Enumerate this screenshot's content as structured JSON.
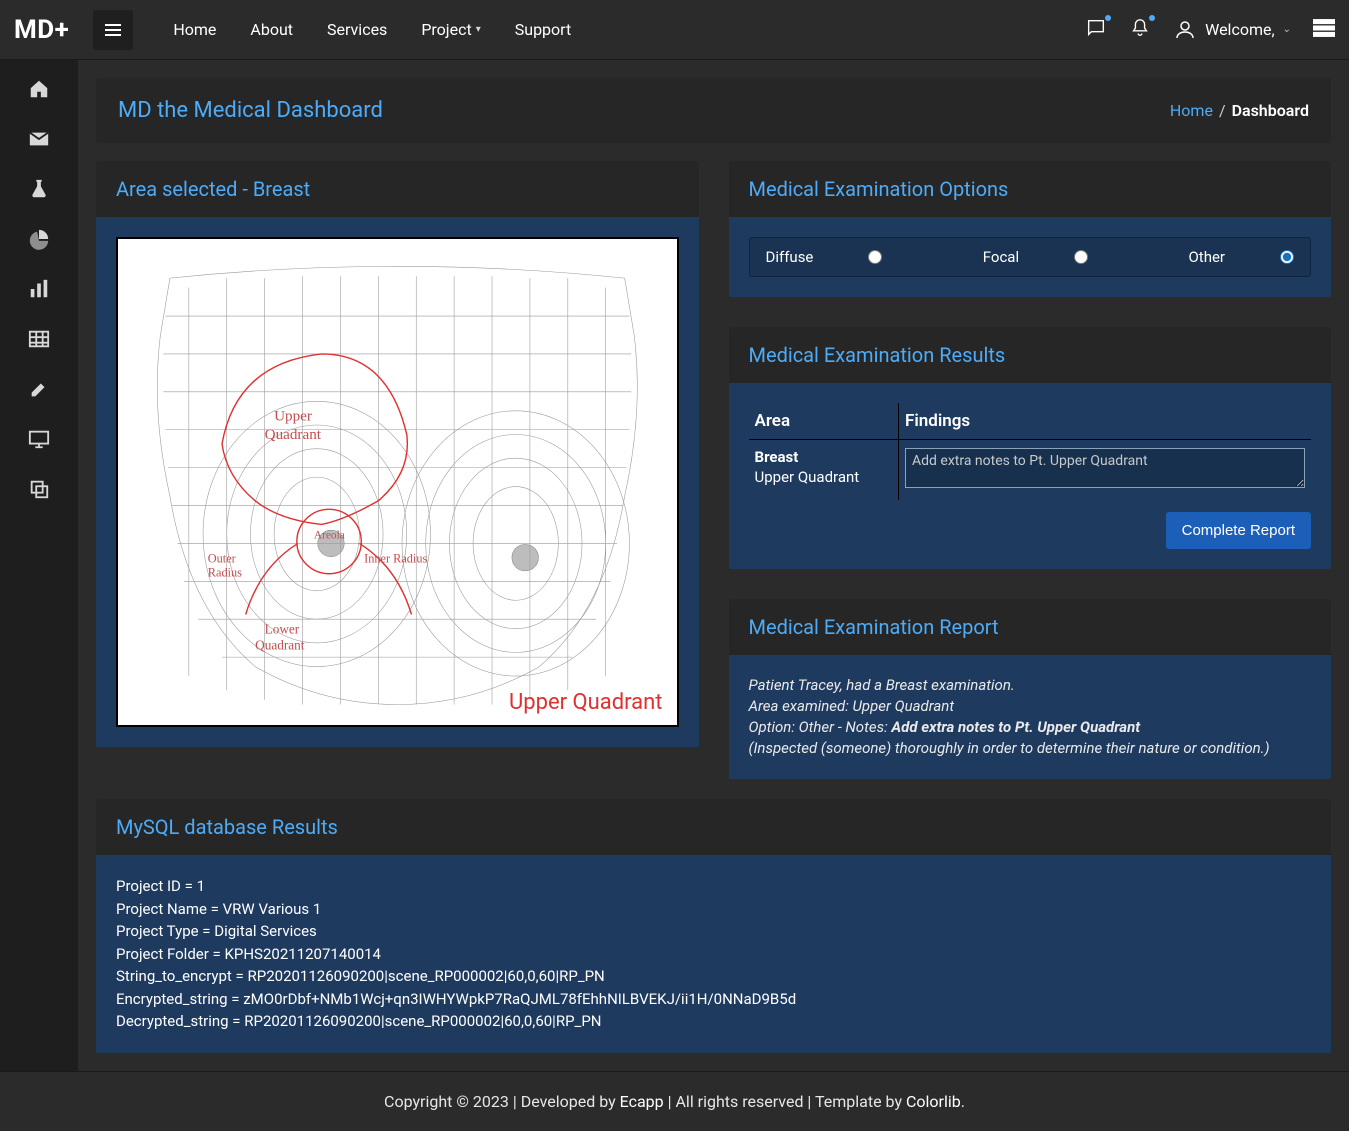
{
  "brand": "MD+",
  "topnav": {
    "home": "Home",
    "about": "About",
    "services": "Services",
    "project": "Project",
    "support": "Support"
  },
  "user": {
    "welcome": "Welcome,"
  },
  "page": {
    "title": "MD the Medical Dashboard",
    "breadcrumb_home": "Home",
    "breadcrumb_sep": "/",
    "breadcrumb_current": "Dashboard"
  },
  "area_card": {
    "title": "Area selected - Breast",
    "label": "Upper Quadrant"
  },
  "options_card": {
    "title": "Medical Examination Options",
    "items": [
      {
        "label": "Diffuse",
        "checked": false
      },
      {
        "label": "Focal",
        "checked": false
      },
      {
        "label": "Other",
        "checked": true
      }
    ]
  },
  "results_card": {
    "title": "Medical Examination Results",
    "col_area": "Area",
    "col_findings": "Findings",
    "area_name": "Breast",
    "area_sub": "Upper Quadrant",
    "textarea_value": "Add extra notes to Pt. Upper Quadrant",
    "button": "Complete Report"
  },
  "report_card": {
    "title": "Medical Examination Report",
    "line1": "Patient Tracey, had a Breast examination.",
    "line2": "Area examined: Upper Quadrant",
    "line3_prefix": "Option: Other - Notes: ",
    "line3_notes": "Add extra notes to Pt. Upper Quadrant",
    "line4": "(Inspected (someone) thoroughly in order to determine their nature or condition.)"
  },
  "mysql_card": {
    "title": "MySQL database Results",
    "lines": [
      "Project ID = 1",
      "Project Name = VRW Various 1",
      "Project Type = Digital Services",
      "Project Folder = KPHS20211207140014",
      "String_to_encrypt = RP20201126090200|scene_RP000002|60,0,60|RP_PN",
      "Encrypted_string = zMO0rDbf+NMb1Wcj+qn3IWHYWpkP7RaQJML78fEhhNILBVEKJ/ii1H/0NNaD9B5d",
      "Decrypted_string = RP20201126090200|scene_RP000002|60,0,60|RP_PN"
    ]
  },
  "footer": {
    "text_before": "Copyright © 2023 | Developed by ",
    "link1": "Ecapp",
    "text_mid": " | All rights reserved | Template by ",
    "link2": "Colorlib",
    "text_after": "."
  }
}
